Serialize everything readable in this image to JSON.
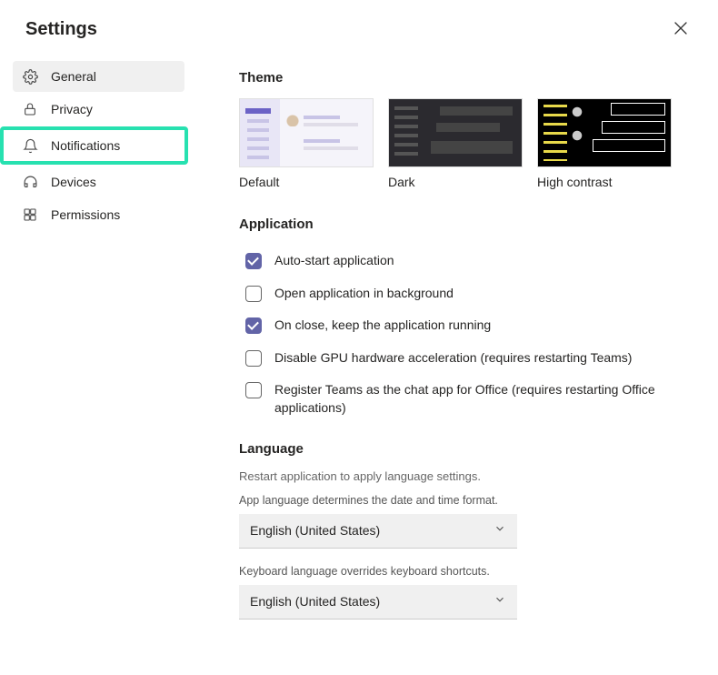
{
  "header": {
    "title": "Settings"
  },
  "sidebar": {
    "items": [
      {
        "label": "General"
      },
      {
        "label": "Privacy"
      },
      {
        "label": "Notifications"
      },
      {
        "label": "Devices"
      },
      {
        "label": "Permissions"
      }
    ]
  },
  "main": {
    "theme": {
      "title": "Theme",
      "options": [
        {
          "label": "Default"
        },
        {
          "label": "Dark"
        },
        {
          "label": "High contrast"
        }
      ]
    },
    "application": {
      "title": "Application",
      "checkboxes": [
        {
          "label": "Auto-start application",
          "checked": true
        },
        {
          "label": "Open application in background",
          "checked": false
        },
        {
          "label": "On close, keep the application running",
          "checked": true
        },
        {
          "label": "Disable GPU hardware acceleration (requires restarting Teams)",
          "checked": false
        },
        {
          "label": "Register Teams as the chat app for Office (requires restarting Office applications)",
          "checked": false
        }
      ]
    },
    "language": {
      "title": "Language",
      "note": "Restart application to apply language settings.",
      "app_lang_label": "App language determines the date and time format.",
      "app_lang_value": "English (United States)",
      "keyboard_label": "Keyboard language overrides keyboard shortcuts.",
      "keyboard_value": "English (United States)"
    }
  }
}
